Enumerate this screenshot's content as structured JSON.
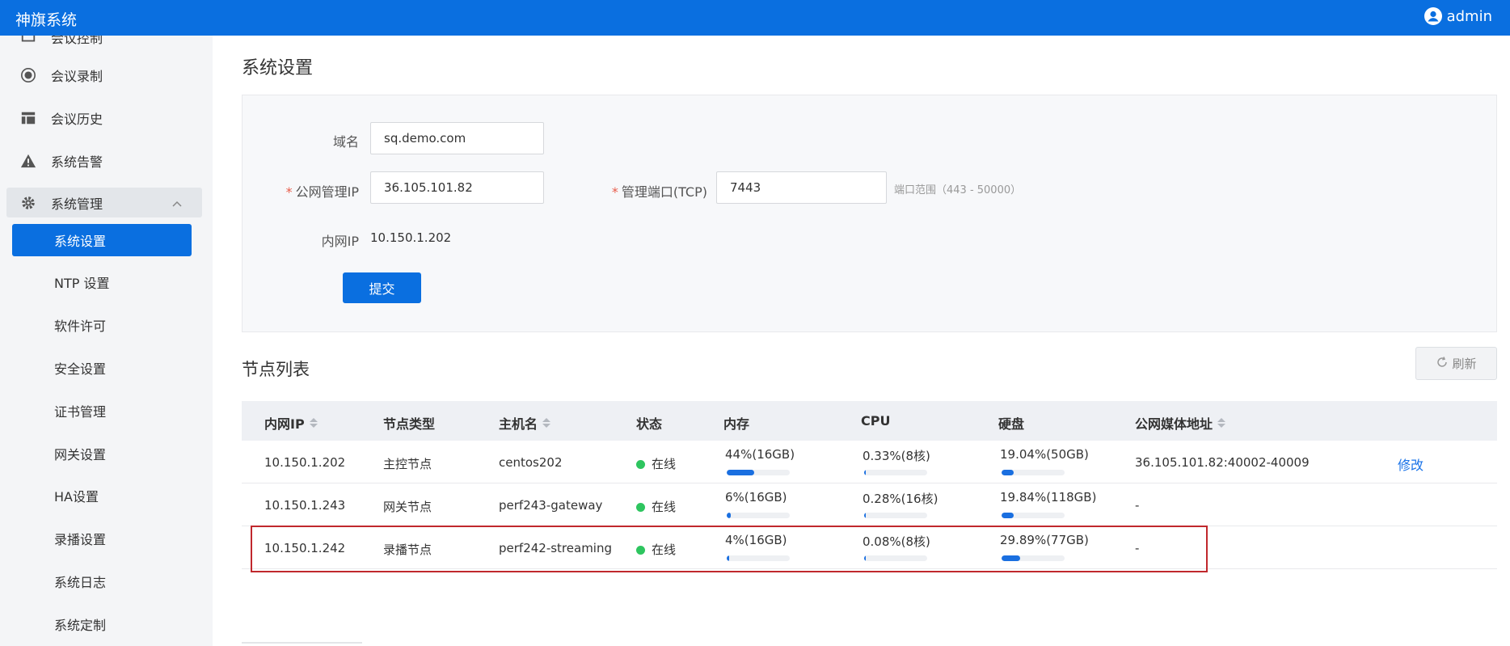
{
  "header": {
    "app_title": "神旗系统",
    "user": "admin"
  },
  "sidebar": {
    "items": [
      {
        "label": "会议控制",
        "icon": "control-icon"
      },
      {
        "label": "会议录制",
        "icon": "record-icon"
      },
      {
        "label": "会议历史",
        "icon": "table-icon"
      },
      {
        "label": "系统告警",
        "icon": "warning-icon"
      }
    ],
    "group": {
      "label": "系统管理",
      "icon": "gear-icon",
      "expanded": true
    },
    "sub_items": [
      "系统设置",
      "NTP 设置",
      "软件许可",
      "安全设置",
      "证书管理",
      "网关设置",
      "HA设置",
      "录播设置",
      "系统日志",
      "系统定制"
    ],
    "active": "系统设置"
  },
  "page": {
    "title": "系统设置"
  },
  "form": {
    "domain_label": "域名",
    "domain_value": "sq.demo.com",
    "public_ip_label": "公网管理IP",
    "public_ip_value": "36.105.101.82",
    "port_label": "管理端口(TCP)",
    "port_value": "7443",
    "port_hint": "端口范围（443 - 50000）",
    "lan_ip_label": "内网IP",
    "lan_ip_value": "10.150.1.202",
    "submit_label": "提交",
    "required_mark": "*"
  },
  "nodes": {
    "title": "节点列表",
    "refresh_label": "刷新",
    "columns": [
      "内网IP",
      "节点类型",
      "主机名",
      "状态",
      "内存",
      "CPU",
      "硬盘",
      "公网媒体地址"
    ],
    "rows": [
      {
        "ip": "10.150.1.202",
        "type": "主控节点",
        "host": "centos202",
        "status": "在线",
        "mem": "44%(16GB)",
        "mem_pct": 44,
        "cpu": "0.33%(8核)",
        "cpu_pct": 0.33,
        "disk": "19.04%(50GB)",
        "disk_pct": 19.04,
        "media": "36.105.101.82:40002-40009",
        "action": "修改"
      },
      {
        "ip": "10.150.1.243",
        "type": "网关节点",
        "host": "perf243-gateway",
        "status": "在线",
        "mem": "6%(16GB)",
        "mem_pct": 6,
        "cpu": "0.28%(16核)",
        "cpu_pct": 0.28,
        "disk": "19.84%(118GB)",
        "disk_pct": 19.84,
        "media": "-",
        "action": ""
      },
      {
        "ip": "10.150.1.242",
        "type": "录播节点",
        "host": "perf242-streaming",
        "status": "在线",
        "mem": "4%(16GB)",
        "mem_pct": 4,
        "cpu": "0.08%(8核)",
        "cpu_pct": 0.08,
        "disk": "29.89%(77GB)",
        "disk_pct": 29.89,
        "media": "-",
        "action": ""
      }
    ]
  },
  "colors": {
    "primary": "#0a6fe0",
    "online": "#2ec55f",
    "highlight": "#c0282d"
  }
}
